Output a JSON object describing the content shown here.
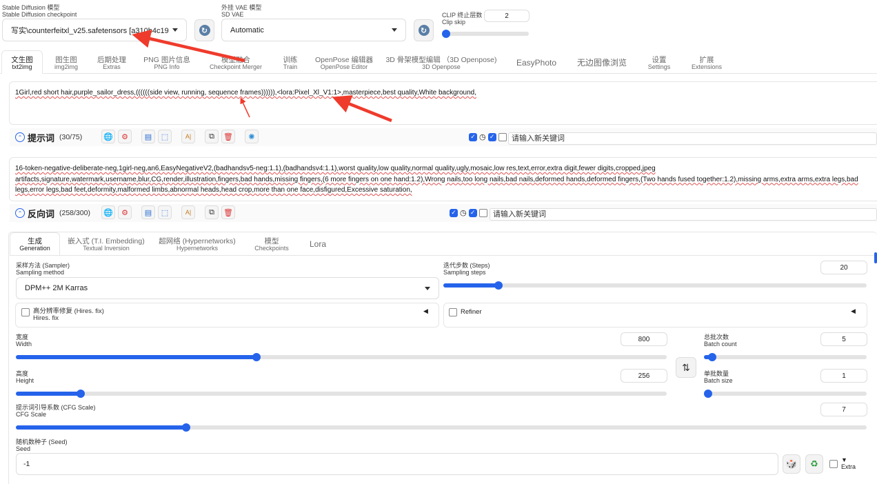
{
  "top": {
    "sd_model_label_zh": "Stable Diffusion 模型",
    "sd_model_label_en": "Stable Diffusion checkpoint",
    "sd_model_value": "写实\\counterfeitxl_v25.safetensors [a310b4c19",
    "vae_label_zh": "外挂 VAE 模型",
    "vae_label_en": "SD VAE",
    "vae_value": "Automatic",
    "clip_label_zh": "CLIP 终止层数",
    "clip_label_en": "Clip skip",
    "clip_value": "2",
    "clip_fraction": 0.0
  },
  "tabs": [
    {
      "zh": "文生图",
      "en": "txt2img",
      "active": true
    },
    {
      "zh": "图生图",
      "en": "img2img"
    },
    {
      "zh": "后期处理",
      "en": "Extras"
    },
    {
      "zh": "PNG 图片信息",
      "en": "PNG Info"
    },
    {
      "zh": "模型融合",
      "en": "Checkpoint Merger"
    },
    {
      "zh": "训练",
      "en": "Train"
    },
    {
      "zh": "OpenPose 编辑器",
      "en": "OpenPose Editor"
    },
    {
      "zh": "3D 骨架模型编辑 （3D Openpose)",
      "en": "3D Openpose"
    },
    {
      "zh": "EasyPhoto",
      "en": ""
    },
    {
      "zh": "无边图像浏览",
      "en": ""
    },
    {
      "zh": "设置",
      "en": "Settings"
    },
    {
      "zh": "扩展",
      "en": "Extensions"
    }
  ],
  "positive": {
    "text": "1Girl,red short hair,purple_sailor_dress,((((((side view, running, sequence frames)))))),<lora:Pixel_Xl_V1:1>,masterpiece,best quality,White background,",
    "title": "提示词",
    "count": "(30/75)",
    "keyword_placeholder": "请输入新关键词"
  },
  "negative": {
    "text": "16-token-negative-deliberate-neg,1girl-neg,an6,EasyNegativeV2,(badhandsv5-neg:1.1),(badhandsv4:1.1),worst quality,low quality,normal quality,ugly,mosaic,low res,text,error,extra digit,fewer digits,cropped,jpeg artifacts,signature,watermark,username,blur,CG,render,illustration,fingers,bad hands,missing fingers,(6 more fingers on one hand:1.2),Wrong nails,too long nails,bad nails,deformed hands,deformed fingers,(Two hands fused together:1.2),missing arms,extra arms,extra legs,bad legs,error legs,bad feet,deformity,malformed limbs,abnormal heads,head crop,more than one face,disfigured,Excessive saturation,",
    "title": "反向词",
    "count": "(258/300)",
    "keyword_placeholder": "请输入新关键词"
  },
  "subtabs": [
    {
      "zh": "生成",
      "en": "Generation",
      "active": true
    },
    {
      "zh": "嵌入式 (T.I. Embedding)",
      "en": "Textual Inversion"
    },
    {
      "zh": "超网络 (Hypernetworks)",
      "en": "Hypernetworks"
    },
    {
      "zh": "模型",
      "en": "Checkpoints"
    },
    {
      "zh": "Lora",
      "en": ""
    }
  ],
  "params": {
    "sampler_label_zh": "采样方法 (Sampler)",
    "sampler_label_en": "Sampling method",
    "sampler_value": "DPM++ 2M Karras",
    "steps_label_zh": "迭代步数 (Steps)",
    "steps_label_en": "Sampling steps",
    "steps_value": "20",
    "steps_fraction": 0.13,
    "hires_zh": "高分辨率修复 (Hires. fix)",
    "hires_en": "Hires. fix",
    "refiner": "Refiner",
    "width_zh": "宽度",
    "width_en": "Width",
    "width_value": "800",
    "width_fraction": 0.37,
    "height_zh": "高度",
    "height_en": "Height",
    "height_value": "256",
    "height_fraction": 0.1,
    "batch_count_zh": "总批次数",
    "batch_count_en": "Batch count",
    "batch_count_value": "5",
    "batch_count_fraction": 0.05,
    "batch_size_zh": "单批数量",
    "batch_size_en": "Batch size",
    "batch_size_value": "1",
    "batch_size_fraction": 0.0,
    "cfg_zh": "提示词引导系数 (CFG Scale)",
    "cfg_en": "CFG Scale",
    "cfg_value": "7",
    "cfg_fraction": 0.2,
    "seed_zh": "随机数种子 (Seed)",
    "seed_en": "Seed",
    "seed_value": "-1",
    "extra_label": "Extra"
  },
  "colors": {
    "accent": "#2563eb",
    "annotation": "#ef3b2c"
  },
  "icons": [
    "refresh-icon",
    "globe-icon",
    "gear-icon",
    "import-icon",
    "save-icon",
    "translate-icon",
    "copy-icon",
    "trash-icon",
    "openai-icon",
    "dice-icon",
    "recycle-icon",
    "swap-icon"
  ]
}
